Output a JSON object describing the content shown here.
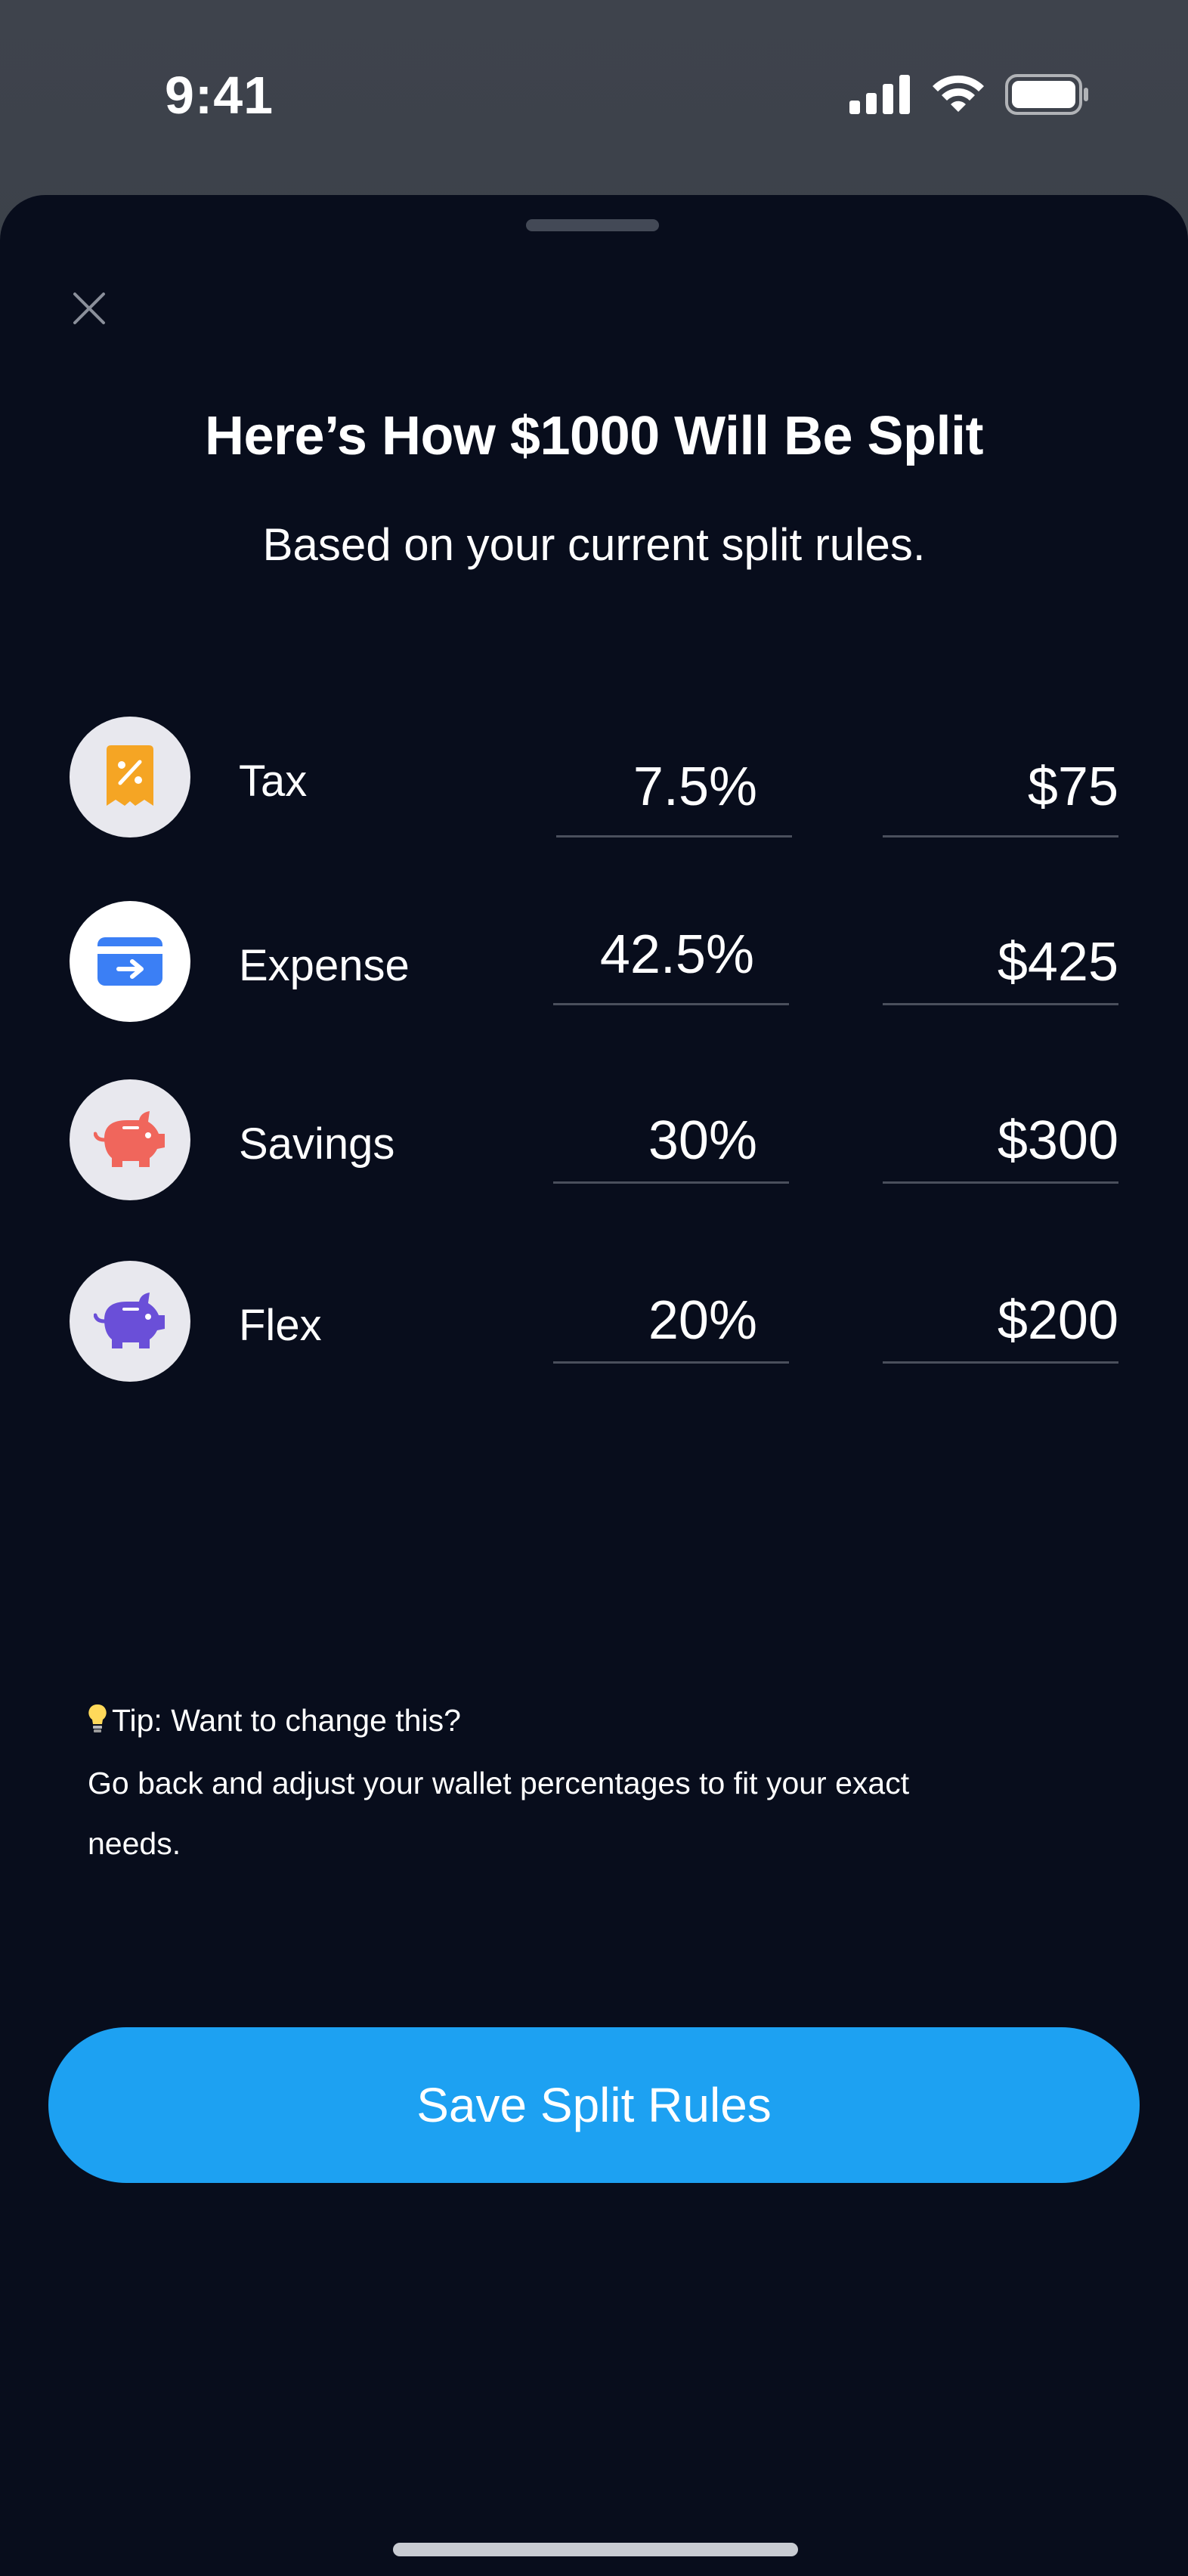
{
  "status_bar": {
    "time": "9:41"
  },
  "sheet": {
    "title": "Here’s How $1000 Will Be Split",
    "subtitle": "Based on your current split rules."
  },
  "rows": [
    {
      "label": "Tax",
      "percent": "7.5%",
      "amount": "$75",
      "icon": "receipt-percent-icon",
      "icon_color": "#f5a524"
    },
    {
      "label": "Expense",
      "percent": "42.5%",
      "amount": "$425",
      "icon": "card-transfer-icon",
      "icon_color": "#3b7ff5"
    },
    {
      "label": "Savings",
      "percent": "30%",
      "amount": "$300",
      "icon": "piggy-bank-icon",
      "icon_color": "#f0665c"
    },
    {
      "label": "Flex",
      "percent": "20%",
      "amount": "$200",
      "icon": "piggy-bank-icon",
      "icon_color": "#6a4fd8"
    }
  ],
  "tip": {
    "line1": "Tip: Want to change this?",
    "line2": " Go back and adjust your wallet percentages to fit your exact",
    "line3": "needs."
  },
  "save_button": {
    "label": "Save Split Rules"
  },
  "colors": {
    "accent": "#1da1f2",
    "sheet_bg": "#080d1c"
  }
}
